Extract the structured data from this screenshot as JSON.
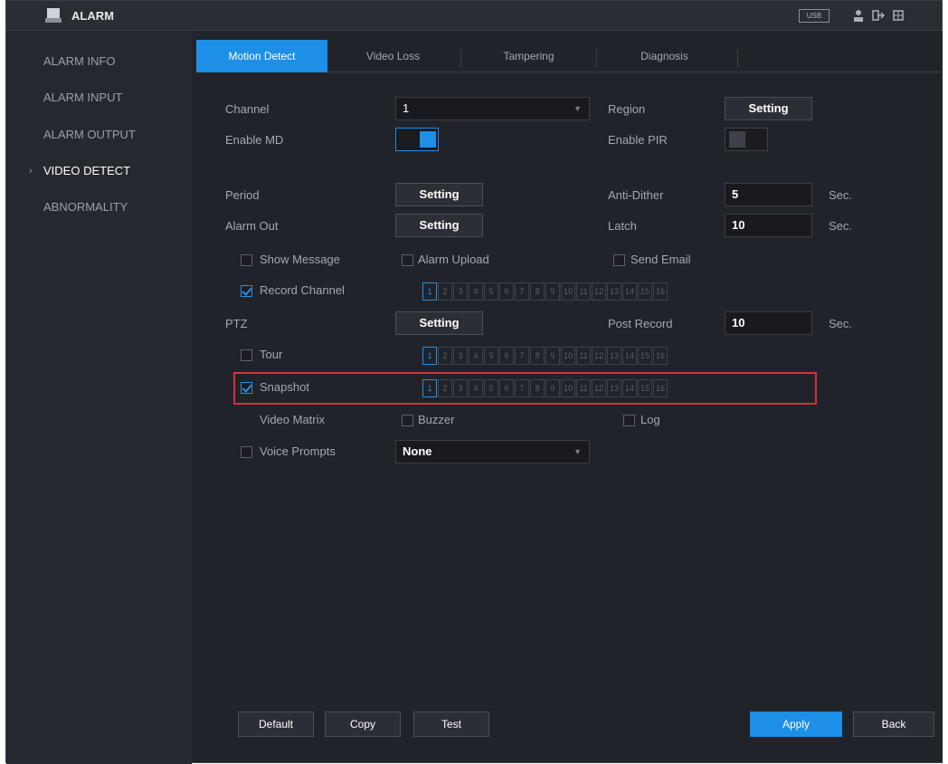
{
  "app": {
    "title": "ALARM",
    "usb_label": "USB"
  },
  "sidebar": {
    "items": [
      {
        "label": "ALARM INFO"
      },
      {
        "label": "ALARM INPUT"
      },
      {
        "label": "ALARM OUTPUT"
      },
      {
        "label": "VIDEO DETECT"
      },
      {
        "label": "ABNORMALITY"
      }
    ],
    "active": "VIDEO DETECT"
  },
  "tabs": [
    {
      "label": "Motion Detect"
    },
    {
      "label": "Video Loss"
    },
    {
      "label": "Tampering"
    },
    {
      "label": "Diagnosis"
    }
  ],
  "form": {
    "channel_label": "Channel",
    "channel_value": "1",
    "region_label": "Region",
    "region_button": "Setting",
    "enable_md_label": "Enable MD",
    "enable_md": true,
    "enable_pir_label": "Enable PIR",
    "enable_pir": false,
    "period_label": "Period",
    "period_button": "Setting",
    "anti_dither_label": "Anti-Dither",
    "anti_dither_value": "5",
    "anti_dither_unit": "Sec.",
    "alarm_out_label": "Alarm Out",
    "alarm_out_button": "Setting",
    "latch_label": "Latch",
    "latch_value": "10",
    "latch_unit": "Sec.",
    "show_message_label": "Show Message",
    "alarm_upload_label": "Alarm Upload",
    "send_email_label": "Send Email",
    "record_channel_label": "Record Channel",
    "ptz_label": "PTZ",
    "ptz_button": "Setting",
    "post_record_label": "Post Record",
    "post_record_value": "10",
    "post_record_unit": "Sec.",
    "tour_label": "Tour",
    "snapshot_label": "Snapshot",
    "video_matrix_label": "Video Matrix",
    "buzzer_label": "Buzzer",
    "log_label": "Log",
    "voice_prompts_label": "Voice Prompts",
    "voice_prompts_value": "None"
  },
  "channels": [
    "1",
    "2",
    "3",
    "4",
    "5",
    "6",
    "7",
    "8",
    "9",
    "10",
    "11",
    "12",
    "13",
    "14",
    "15",
    "16"
  ],
  "footer": {
    "default": "Default",
    "copy": "Copy",
    "test": "Test",
    "apply": "Apply",
    "back": "Back"
  },
  "colors": {
    "accent": "#1e8fe6",
    "highlight": "#d6303f",
    "background": "#202329"
  }
}
